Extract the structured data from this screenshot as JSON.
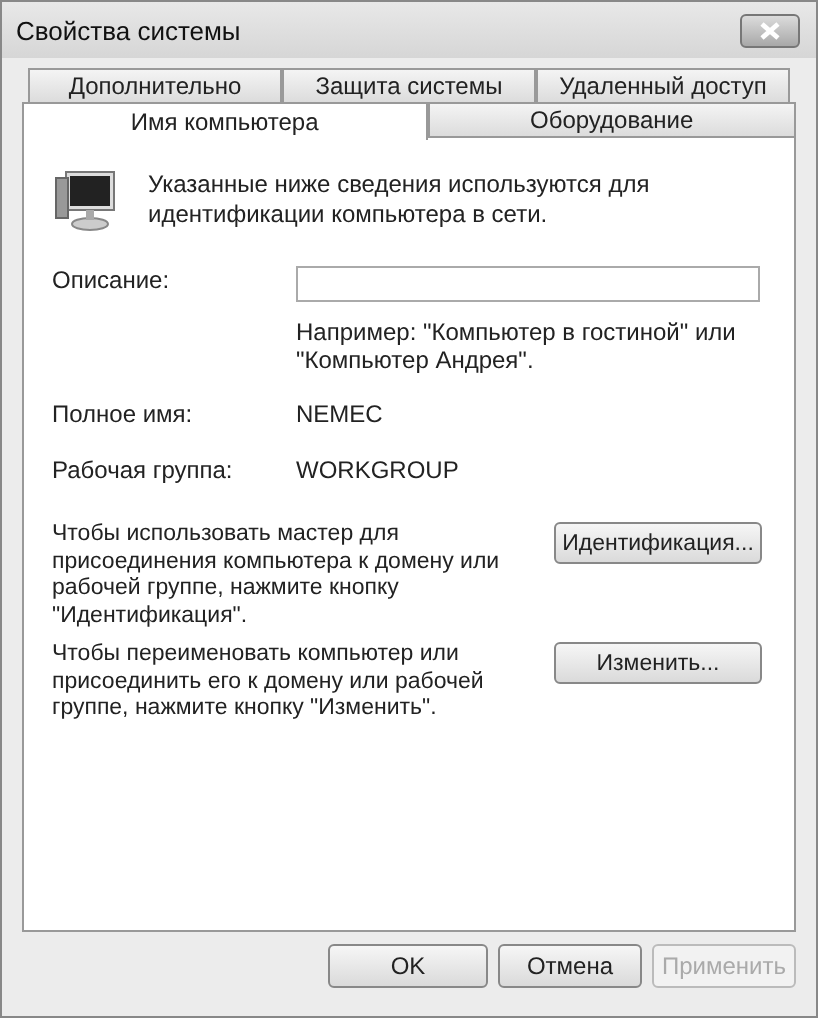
{
  "window": {
    "title": "Свойства системы"
  },
  "tabs": [
    [
      {
        "label": "Дополнительно",
        "selected": false
      },
      {
        "label": "Защита системы",
        "selected": false
      },
      {
        "label": "Удаленный доступ",
        "selected": false
      }
    ],
    [
      {
        "label": "Имя компьютера",
        "selected": true
      },
      {
        "label": "Оборудование",
        "selected": false
      }
    ]
  ],
  "intro": "Указанные ниже сведения используются для идентификации компьютера в сети.",
  "description": {
    "label": "Описание:"
  },
  "hint": "Например: \"Компьютер в гостиной\" или \"Компьютер Андрея\".",
  "info": [
    {
      "label": "Полное имя:",
      "value": "NEMEC"
    },
    {
      "label": "Рабочая группа:",
      "value": "WORKGROUP"
    }
  ],
  "actions": [
    {
      "text": "Чтобы использовать мастер для присоединения компьютера к домену или рабочей группе, нажмите кнопку \"Идентификация\".",
      "button": "Идентификация..."
    },
    {
      "text": "Чтобы переименовать компьютер или присоединить его к домену или рабочей группе, нажмите кнопку \"Изменить\".",
      "button": "Изменить..."
    }
  ],
  "buttons": [
    {
      "label": "OK",
      "disabled": false
    },
    {
      "label": "Отмена",
      "disabled": false
    },
    {
      "label": "Применить",
      "disabled": true
    }
  ]
}
